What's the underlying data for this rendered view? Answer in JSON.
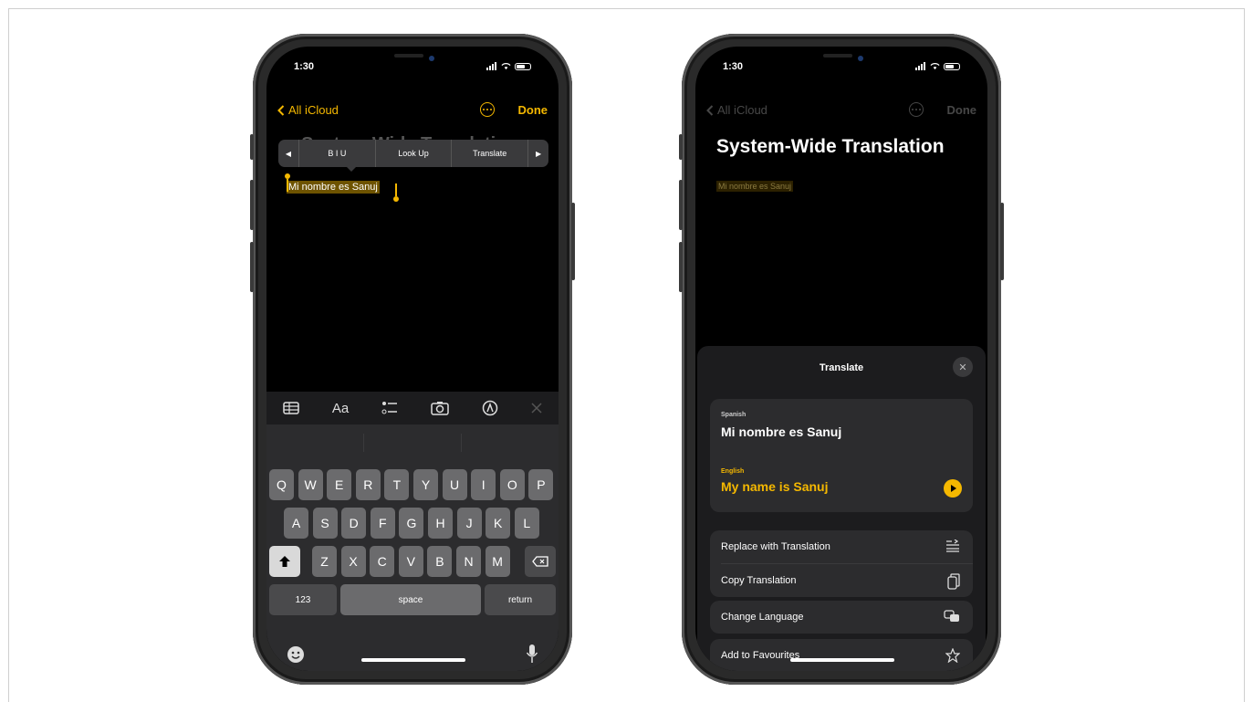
{
  "status": {
    "time": "1:30"
  },
  "nav": {
    "back_label": "All iCloud",
    "done_label": "Done"
  },
  "note": {
    "title": "System-Wide Translation",
    "selected_text": "Mi nombre es Sanuj"
  },
  "popover": {
    "format_label": "B I U",
    "lookup_label": "Look Up",
    "translate_label": "Translate"
  },
  "toolbar": {
    "icons": [
      "table-icon",
      "text-format-icon",
      "checklist-icon",
      "camera-icon",
      "markup-icon",
      "close-icon"
    ],
    "format_label": "Aa"
  },
  "keyboard": {
    "row1": [
      "Q",
      "W",
      "E",
      "R",
      "T",
      "Y",
      "U",
      "I",
      "O",
      "P"
    ],
    "row2": [
      "A",
      "S",
      "D",
      "F",
      "G",
      "H",
      "J",
      "K",
      "L"
    ],
    "row3": [
      "Z",
      "X",
      "C",
      "V",
      "B",
      "N",
      "M"
    ],
    "numbers_label": "123",
    "space_label": "space",
    "return_label": "return"
  },
  "translate_sheet": {
    "title": "Translate",
    "source_language": "Spanish",
    "source_text": "Mi nombre es Sanuj",
    "target_language": "English",
    "target_text": "My name is Sanuj",
    "actions": {
      "replace": "Replace with Translation",
      "copy": "Copy Translation",
      "change_language": "Change Language",
      "add_favourites": "Add to Favourites"
    }
  },
  "colors": {
    "accent": "#f5b800",
    "sheet_bg": "#1c1c1e",
    "card_bg": "#2c2c2e"
  }
}
